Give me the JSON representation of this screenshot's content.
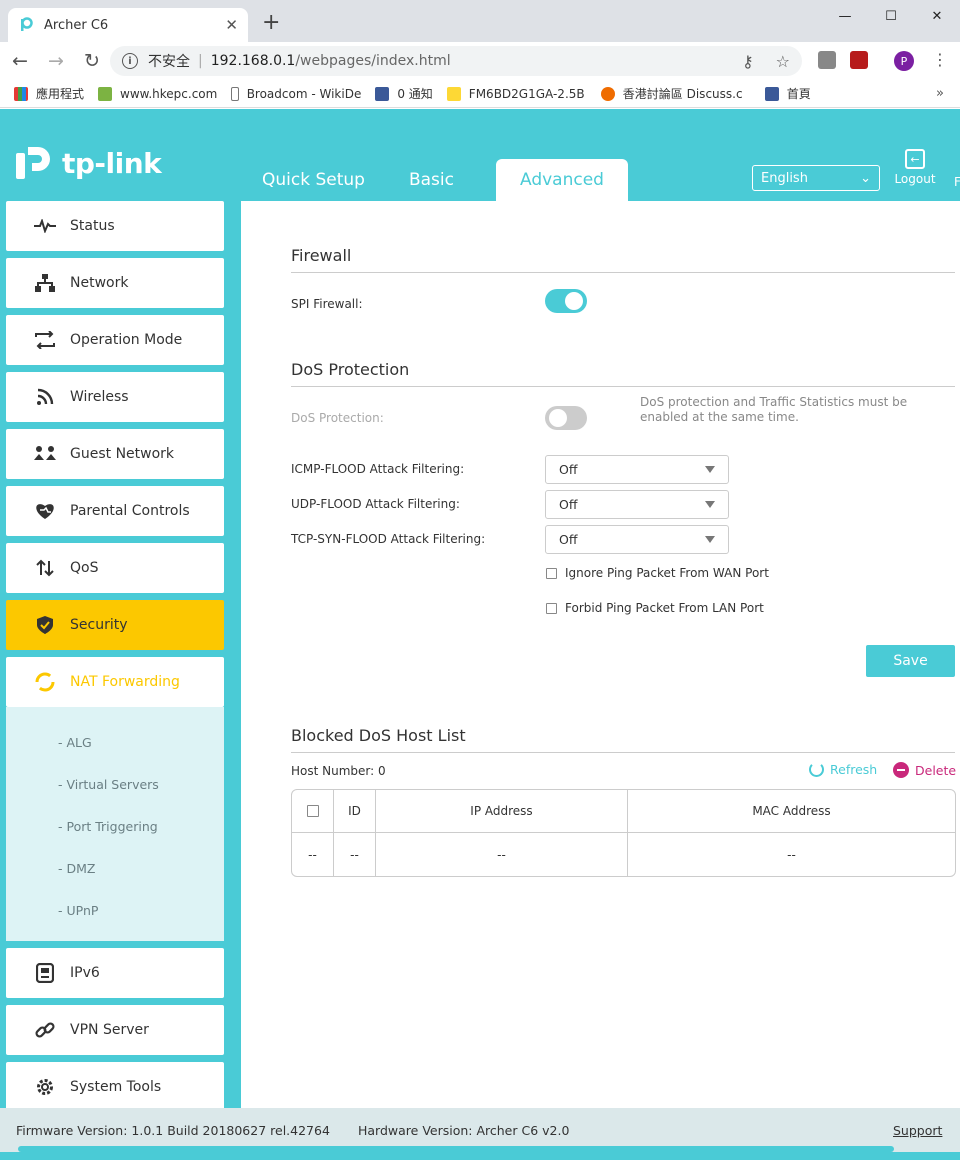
{
  "browser": {
    "tab_title": "Archer C6",
    "new_tab": "+",
    "address": {
      "security": "不安全",
      "host": "192.168.0.1",
      "path": "/webpages/index.html"
    },
    "profile_initial": "P",
    "bookmarks": [
      {
        "label": "應用程式",
        "icon": "apps-grid-icon"
      },
      {
        "label": "www.hkepc.com",
        "icon": "hkepc-icon"
      },
      {
        "label": "Broadcom - WikiDe",
        "icon": "page-icon"
      },
      {
        "label": "0 通知",
        "icon": "facebook-icon"
      },
      {
        "label": "FM6BD2G1GA-2.5B",
        "icon": "bee-icon"
      },
      {
        "label": "香港討論區 Discuss.c",
        "icon": "chat-bubble-icon"
      },
      {
        "label": "首頁",
        "icon": "facebook-icon"
      }
    ],
    "bookmarks_more": "»"
  },
  "app": {
    "logo_text": "tp-link",
    "main_tabs": [
      {
        "label": "Quick Setup"
      },
      {
        "label": "Basic"
      },
      {
        "label": "Advanced"
      }
    ],
    "language": "English",
    "logout": "Logout",
    "right_cut": "F",
    "sidebar": [
      {
        "label": "Status",
        "icon": "pulse-icon"
      },
      {
        "label": "Network",
        "icon": "network-tree-icon"
      },
      {
        "label": "Operation Mode",
        "icon": "swap-arrows-icon"
      },
      {
        "label": "Wireless",
        "icon": "wifi-signal-icon"
      },
      {
        "label": "Guest Network",
        "icon": "guest-users-icon"
      },
      {
        "label": "Parental Controls",
        "icon": "heart-icon"
      },
      {
        "label": "QoS",
        "icon": "updown-arrows-icon"
      },
      {
        "label": "Security",
        "icon": "shield-icon"
      },
      {
        "label": "NAT Forwarding",
        "icon": "nat-cycle-icon"
      },
      {
        "label": "IPv6",
        "icon": "ipv6-document-icon"
      },
      {
        "label": "VPN Server",
        "icon": "link-icon"
      },
      {
        "label": "System Tools",
        "icon": "gear-icon"
      }
    ],
    "nat_submenu": [
      "- ALG",
      "- Virtual Servers",
      "- Port Triggering",
      "- DMZ",
      "- UPnP"
    ],
    "firewall": {
      "title": "Firewall",
      "spi_label": "SPI Firewall:",
      "spi_enabled": true
    },
    "dos": {
      "title": "DoS Protection",
      "dos_label": "DoS Protection:",
      "dos_enabled": false,
      "note": "DoS protection and Traffic Statistics must be enabled at the same time.",
      "icmp_label": "ICMP-FLOOD Attack Filtering:",
      "icmp_value": "Off",
      "udp_label": "UDP-FLOOD Attack Filtering:",
      "udp_value": "Off",
      "tcp_label": "TCP-SYN-FLOOD Attack Filtering:",
      "tcp_value": "Off",
      "ignore_ping": "Ignore Ping Packet From WAN Port",
      "forbid_ping": "Forbid Ping Packet From LAN Port",
      "save": "Save"
    },
    "blocked": {
      "title": "Blocked DoS Host List",
      "host_number": "Host Number:  0",
      "refresh": "Refresh",
      "delete": "Delete",
      "columns": [
        "ID",
        "IP Address",
        "MAC Address"
      ],
      "empty_row": [
        "--",
        "--",
        "--",
        "--"
      ]
    },
    "footer": {
      "firmware": "Firmware Version: 1.0.1 Build 20180627 rel.42764",
      "hardware": "Hardware Version: Archer C6 v2.0",
      "support": "Support"
    }
  }
}
